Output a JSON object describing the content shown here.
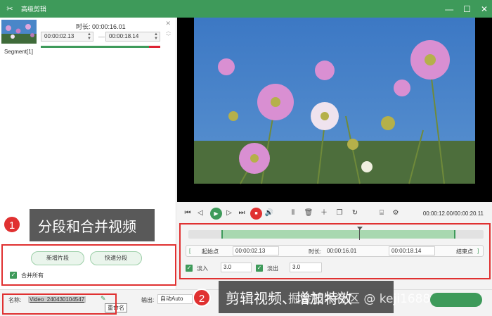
{
  "window": {
    "title": "高级剪辑",
    "minimize": "—",
    "maximize": "☐",
    "close": "✕"
  },
  "segment": {
    "label": "Segment[1]",
    "duration_label": "时长:",
    "duration_value": "00:00:16.01",
    "start": "00:00:02.13",
    "end": "00:00:18.14",
    "separator": "—"
  },
  "left_actions": {
    "new_segment": "新增片段",
    "quick_split": "快速分段",
    "merge_all": "合并所有"
  },
  "bottom": {
    "name_label": "名称:",
    "name_value": "Video_240430104547",
    "rename_tooltip": "重命名",
    "output_label": "输出:",
    "output_value": "自动Auto"
  },
  "player": {
    "time_readout": "00:00:12.00/00:00:20.11"
  },
  "clip": {
    "start_button": "起始点",
    "start_value": "00:00:02.13",
    "duration_label": "时长:",
    "duration_value": "00:00:16.01",
    "end_value": "00:00:18.14",
    "end_button": "结束点",
    "fade_in_label": "淡入",
    "fade_in_value": "3.0",
    "fade_out_label": "淡出",
    "fade_out_value": "3.0"
  },
  "annotations": {
    "badge1": "1",
    "label1": "分段和合并视频",
    "badge2": "2",
    "label2": "剪辑视频、增加特效",
    "watermark": "掘金技术社区 @ keji1688"
  },
  "colors": {
    "accent": "#3e9a5a",
    "highlight": "#e03131"
  }
}
